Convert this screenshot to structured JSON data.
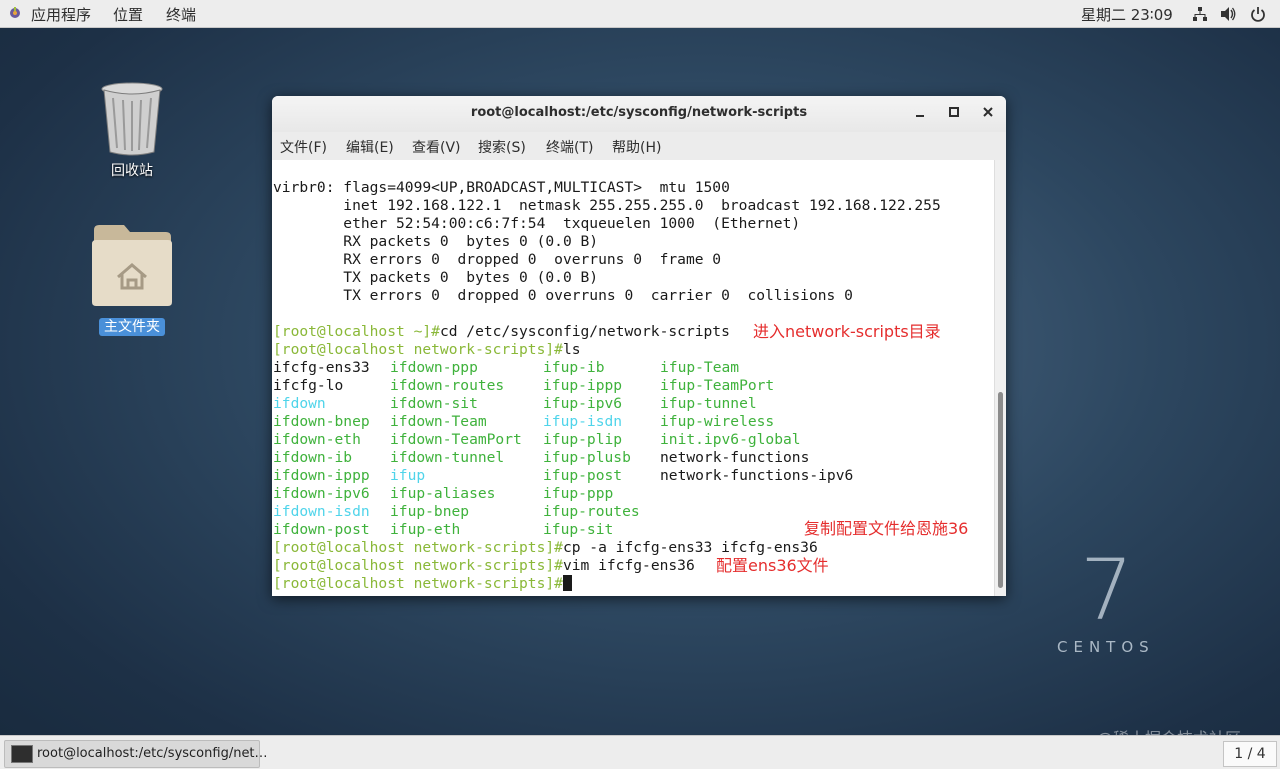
{
  "top_panel": {
    "applications": "应用程序",
    "places": "位置",
    "terminal": "终端",
    "clock": "星期二 23∶09"
  },
  "desktop": {
    "trash_label": "回收站",
    "home_label": "主文件夹",
    "logo_number": "7",
    "logo_text": "CENTOS",
    "watermark": "@稀土掘金技术社区"
  },
  "window": {
    "title": "root@localhost:/etc/sysconfig/network-scripts",
    "menu": [
      "文件(F)",
      "编辑(E)",
      "查看(V)",
      "搜索(S)",
      "终端(T)",
      "帮助(H)"
    ]
  },
  "terminal": {
    "virbr0": [
      "virbr0: flags=4099<UP,BROADCAST,MULTICAST>  mtu 1500",
      "        inet 192.168.122.1  netmask 255.255.255.0  broadcast 192.168.122.255",
      "        ether 52:54:00:c6:7f:54  txqueuelen 1000  (Ethernet)",
      "        RX packets 0  bytes 0 (0.0 B)",
      "        RX errors 0  dropped 0  overruns 0  frame 0",
      "        TX packets 0  bytes 0 (0.0 B)",
      "        TX errors 0  dropped 0 overruns 0  carrier 0  collisions 0"
    ],
    "prompt1": "[root@localhost ~]#",
    "cmd1": "cd /etc/sysconfig/network-scripts",
    "prompt2": "[root@localhost network-scripts]#",
    "cmd2": "ls",
    "ls_rows": [
      [
        {
          "t": "ifcfg-ens33",
          "c": ""
        },
        {
          "t": "ifdown-ppp",
          "c": "green"
        },
        {
          "t": "ifup-ib",
          "c": "green"
        },
        {
          "t": "ifup-Team",
          "c": "green"
        }
      ],
      [
        {
          "t": "ifcfg-lo",
          "c": ""
        },
        {
          "t": "ifdown-routes",
          "c": "green"
        },
        {
          "t": "ifup-ippp",
          "c": "green"
        },
        {
          "t": "ifup-TeamPort",
          "c": "green"
        }
      ],
      [
        {
          "t": "ifdown",
          "c": "cyan"
        },
        {
          "t": "ifdown-sit",
          "c": "green"
        },
        {
          "t": "ifup-ipv6",
          "c": "green"
        },
        {
          "t": "ifup-tunnel",
          "c": "green"
        }
      ],
      [
        {
          "t": "ifdown-bnep",
          "c": "green"
        },
        {
          "t": "ifdown-Team",
          "c": "green"
        },
        {
          "t": "ifup-isdn",
          "c": "cyan"
        },
        {
          "t": "ifup-wireless",
          "c": "green"
        }
      ],
      [
        {
          "t": "ifdown-eth",
          "c": "green"
        },
        {
          "t": "ifdown-TeamPort",
          "c": "green"
        },
        {
          "t": "ifup-plip",
          "c": "green"
        },
        {
          "t": "init.ipv6-global",
          "c": "green"
        }
      ],
      [
        {
          "t": "ifdown-ib",
          "c": "green"
        },
        {
          "t": "ifdown-tunnel",
          "c": "green"
        },
        {
          "t": "ifup-plusb",
          "c": "green"
        },
        {
          "t": "network-functions",
          "c": ""
        }
      ],
      [
        {
          "t": "ifdown-ippp",
          "c": "green"
        },
        {
          "t": "ifup",
          "c": "cyan"
        },
        {
          "t": "ifup-post",
          "c": "green"
        },
        {
          "t": "network-functions-ipv6",
          "c": ""
        }
      ],
      [
        {
          "t": "ifdown-ipv6",
          "c": "green"
        },
        {
          "t": "ifup-aliases",
          "c": "green"
        },
        {
          "t": "ifup-ppp",
          "c": "green"
        },
        {
          "t": "",
          "c": ""
        }
      ],
      [
        {
          "t": "ifdown-isdn",
          "c": "cyan"
        },
        {
          "t": "ifup-bnep",
          "c": "green"
        },
        {
          "t": "ifup-routes",
          "c": "green"
        },
        {
          "t": "",
          "c": ""
        }
      ],
      [
        {
          "t": "ifdown-post",
          "c": "green"
        },
        {
          "t": "ifup-eth",
          "c": "green"
        },
        {
          "t": "ifup-sit",
          "c": "green"
        },
        {
          "t": "",
          "c": ""
        }
      ]
    ],
    "prompt3": "[root@localhost network-scripts]#",
    "cmd3": "cp -a ifcfg-ens33 ifcfg-ens36",
    "prompt4": "[root@localhost network-scripts]#",
    "cmd4": "vim ifcfg-ens36",
    "prompt5": "[root@localhost network-scripts]#"
  },
  "annotations": {
    "a1": "进入network-scripts目录",
    "a2": "复制配置文件给恩施36",
    "a3": "配置ens36文件"
  },
  "taskbar": {
    "task_label": "root@localhost:/etc/sysconfig/net…",
    "workspace": "1 / 4"
  }
}
